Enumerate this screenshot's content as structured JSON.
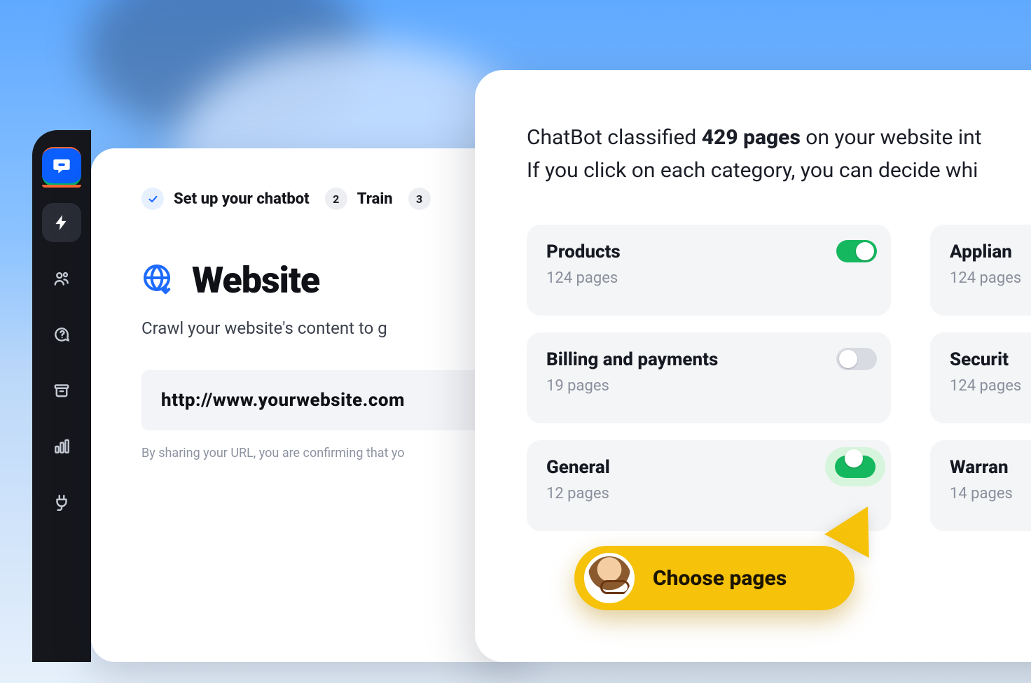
{
  "wizard": {
    "steps": [
      {
        "label": "Set up your chatbot",
        "state": "done"
      },
      {
        "num": "2",
        "label": "Train"
      },
      {
        "num": "3",
        "label": ""
      }
    ]
  },
  "left": {
    "title": "Website",
    "subtitle": "Crawl your website's content to g",
    "url": "http://www.yourwebsite.com",
    "disclaimer": "By sharing your URL, you are confirming that yo"
  },
  "right": {
    "head_a": "ChatBot classified ",
    "head_bold": "429 pages",
    "head_b": " on your website int",
    "head_c": "If you click on each category, you can decide whi",
    "cards": [
      {
        "title": "Products",
        "sub": "124 pages",
        "toggle": true
      },
      {
        "title": "Billing and payments",
        "sub": "19 pages",
        "toggle": false
      },
      {
        "title": "General",
        "sub": "12 pages",
        "toggle": true,
        "highlighted": true
      },
      {
        "title": "Applian",
        "sub": "124 pages"
      },
      {
        "title": "Securit",
        "sub": "124 pages"
      },
      {
        "title": "Warran",
        "sub": "14 pages"
      }
    ]
  },
  "callout": {
    "label": "Choose pages"
  },
  "colors": {
    "accent_blue": "#1e6bff",
    "toggle_on": "#16b85f",
    "callout_bg": "#f6c20a",
    "card_bg": "#f4f5f7"
  },
  "sidebar_icons": [
    "logo",
    "bolt",
    "people",
    "chat-question",
    "archive",
    "bar-chart",
    "plug"
  ]
}
